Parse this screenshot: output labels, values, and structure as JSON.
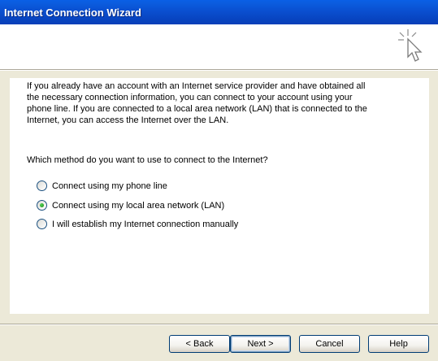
{
  "window": {
    "title": "Internet Connection Wizard"
  },
  "header": {
    "icon": "wizard-cursor-sparkle-icon"
  },
  "body": {
    "intro_lines": [
      "If you already have an account with an Internet service provider and have obtained all",
      "the necessary connection information, you can connect to your account using your",
      "phone line. If you are connected to a local area network (LAN) that is connected to the",
      "Internet, you can access the Internet over the LAN."
    ],
    "question": "Which method do you want to use to connect to the Internet?",
    "options": [
      {
        "label": "Connect using my phone line",
        "checked": false
      },
      {
        "label": "Connect using my local area network (LAN)",
        "checked": true
      },
      {
        "label": "I will establish my Internet connection manually",
        "checked": false
      }
    ]
  },
  "buttons": {
    "back": "< Back",
    "next": "Next >",
    "cancel": "Cancel",
    "help": "Help"
  }
}
